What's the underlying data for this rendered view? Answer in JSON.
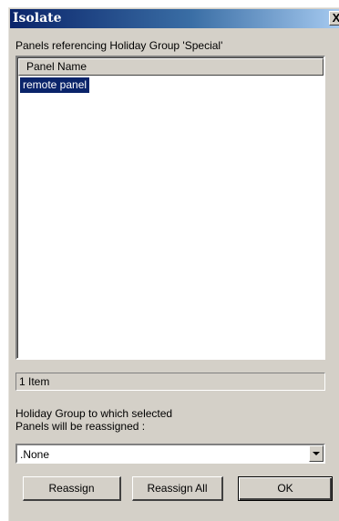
{
  "window": {
    "title": "Isolate",
    "close_label": "X"
  },
  "panels_section": {
    "label": "Panels referencing Holiday Group 'Special'",
    "column_header": "Panel Name",
    "rows": [
      "remote panel"
    ],
    "selected_row": "remote panel",
    "item_count": "1 Item"
  },
  "reassign": {
    "label_line1": "Holiday Group to which selected",
    "label_line2": "Panels will be reassigned :",
    "selected_value": ".None"
  },
  "buttons": {
    "reassign": "Reassign",
    "reassign_all": "Reassign All",
    "ok": "OK"
  }
}
